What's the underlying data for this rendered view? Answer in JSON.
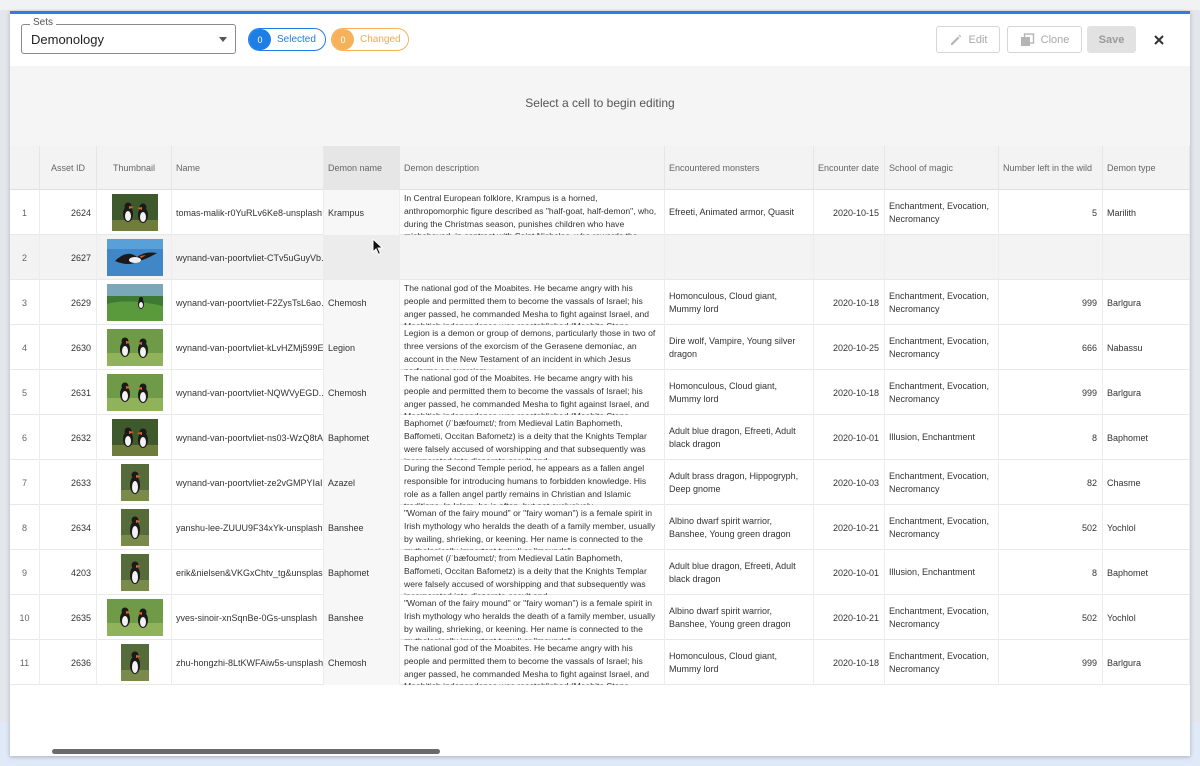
{
  "toolbar": {
    "sets_label": "Sets",
    "sets_value": "Demonology",
    "selected_count": "0",
    "selected_label": "Selected",
    "changed_count": "0",
    "changed_label": "Changed",
    "edit_label": "Edit",
    "clone_label": "Clone",
    "save_label": "Save",
    "close_icon": "close-icon"
  },
  "editor": {
    "hint": "Select a cell to begin editing"
  },
  "columns": [
    "Asset ID",
    "Thumbnail",
    "Name",
    "Demon name",
    "Demon description",
    "Encountered monsters",
    "Encounter date",
    "School of magic",
    "Number left in the wild",
    "Demon type"
  ],
  "rows": [
    {
      "index": "1",
      "asset_id": "2624",
      "thumb": "puffins-pair",
      "name": "tomas-malik-r0YuRLv6Ke8-unsplash",
      "demon_name": "Krampus",
      "description": "In Central European folklore, Krampus is a horned, anthropomorphic figure described as \"half-goat, half-demon\", who, during the Christmas season, punishes children who have misbehaved, in contrast with Saint Nicholas, who rewards the",
      "monsters": "Efreeti, Animated armor, Quasit",
      "date": "2020-10-15",
      "school": "Enchantment, Evocation, Necromancy",
      "number": "5",
      "type": "Marilith"
    },
    {
      "index": "2",
      "asset_id": "2627",
      "thumb": "puffin-flying",
      "name": "wynand-van-poortvliet-CTv5uGuyVb...",
      "demon_name": "",
      "description": "",
      "monsters": "",
      "date": "",
      "school": "",
      "number": "",
      "type": ""
    },
    {
      "index": "3",
      "asset_id": "2629",
      "thumb": "puffin-cliff",
      "name": "wynand-van-poortvliet-F2ZysTsL6ao...",
      "demon_name": "Chemosh",
      "description": "The national god of the Moabites. He became angry with his people and permitted them to become the vassals of Israel; his anger passed, he commanded Mesha to fight against Israel, and Moabitish independence was reestablished (Moabite Stone",
      "monsters": "Homonculous, Cloud giant, Mummy lord",
      "date": "2020-10-18",
      "school": "Enchantment, Evocation, Necromancy",
      "number": "999",
      "type": "Barlgura"
    },
    {
      "index": "4",
      "asset_id": "2630",
      "thumb": "puffins-grass",
      "name": "wynand-van-poortvliet-kLvHZMj599E...",
      "demon_name": "Legion",
      "description": "Legion is a demon or group of demons, particularly those in two of three versions of the exorcism of the Gerasene demoniac, an account in the New Testament of an incident in which Jesus performs an exorcism.",
      "monsters": "Dire wolf, Vampire, Young silver dragon",
      "date": "2020-10-25",
      "school": "Enchantment, Evocation, Necromancy",
      "number": "666",
      "type": "Nabassu"
    },
    {
      "index": "5",
      "asset_id": "2631",
      "thumb": "puffins-grass",
      "name": "wynand-van-poortvliet-NQWVyEGD...",
      "demon_name": "Chemosh",
      "description": "The national god of the Moabites. He became angry with his people and permitted them to become the vassals of Israel; his anger passed, he commanded Mesha to fight against Israel, and Moabitish independence was reestablished (Moabite Stone",
      "monsters": "Homonculous, Cloud giant, Mummy lord",
      "date": "2020-10-18",
      "school": "Enchantment, Evocation, Necromancy",
      "number": "999",
      "type": "Barlgura"
    },
    {
      "index": "6",
      "asset_id": "2632",
      "thumb": "puffins-pair",
      "name": "wynand-van-poortvliet-ns03-WzQ8tA...",
      "demon_name": "Baphomet",
      "description": "Baphomet (/ˈbæfoʊmɛt/; from Medieval Latin Baphometh, Baffometi, Occitan Bafometz) is a deity that the Knights Templar were falsely accused of worshipping and that subsequently was incorporated into disparate occult and",
      "monsters": "Adult blue dragon, Efreeti, Adult black dragon",
      "date": "2020-10-01",
      "school": "Illusion, Enchantment",
      "number": "8",
      "type": "Baphomet"
    },
    {
      "index": "7",
      "asset_id": "2633",
      "thumb": "puffin-tall",
      "name": "wynand-van-poortvliet-ze2vGMPYIaI...",
      "demon_name": "Azazel",
      "description": "During the Second Temple period, he appears as a fallen angel responsible for introducing humans to forbidden knowledge. His role as a fallen angel partly remains in Christian and Islamic traditions. In Islam, he is often, but not exclusively",
      "monsters": "Adult brass dragon, Hippogryph, Deep gnome",
      "date": "2020-10-03",
      "school": "Enchantment, Evocation, Necromancy",
      "number": "82",
      "type": "Chasme"
    },
    {
      "index": "8",
      "asset_id": "2634",
      "thumb": "puffin-tall",
      "name": "yanshu-lee-ZUUU9F34xYk-unsplash",
      "demon_name": "Banshee",
      "description": "\"Woman of the fairy mound\" or \"fairy woman\") is a female spirit in Irish mythology who heralds the death of a family member, usually by wailing, shrieking, or keening. Her name is connected to the mythologically important tumuli or \"mounds\"",
      "monsters": "Albino dwarf spirit warrior, Banshee, Young green dragon",
      "date": "2020-10-21",
      "school": "Enchantment, Evocation, Necromancy",
      "number": "502",
      "type": "Yochlol"
    },
    {
      "index": "9",
      "asset_id": "4203",
      "thumb": "puffin-tall",
      "name": "erik&nielsen&VKGxChtv_tg&unsplas...",
      "demon_name": "Baphomet",
      "description": "Baphomet (/ˈbæfoʊmɛt/; from Medieval Latin Baphometh, Baffometi, Occitan Bafometz) is a deity that the Knights Templar were falsely accused of worshipping and that subsequently was incorporated into disparate occult and",
      "monsters": "Adult blue dragon, Efreeti, Adult black dragon",
      "date": "2020-10-01",
      "school": "Illusion, Enchantment",
      "number": "8",
      "type": "Baphomet"
    },
    {
      "index": "10",
      "asset_id": "2635",
      "thumb": "puffins-grass",
      "name": "yves-sinoir-xnSqnBe-0Gs-unsplash",
      "demon_name": "Banshee",
      "description": "\"Woman of the fairy mound\" or \"fairy woman\") is a female spirit in Irish mythology who heralds the death of a family member, usually by wailing, shrieking, or keening. Her name is connected to the mythologically important tumuli or \"mounds\"",
      "monsters": "Albino dwarf spirit warrior, Banshee, Young green dragon",
      "date": "2020-10-21",
      "school": "Enchantment, Evocation, Necromancy",
      "number": "502",
      "type": "Yochlol"
    },
    {
      "index": "11",
      "asset_id": "2636",
      "thumb": "puffin-tall",
      "name": "zhu-hongzhi-8LtKWFAiw5s-unsplash",
      "demon_name": "Chemosh",
      "description": "The national god of the Moabites. He became angry with his people and permitted them to become the vassals of Israel; his anger passed, he commanded Mesha to fight against Israel, and Moabitish independence was reestablished (Moabite Stone",
      "monsters": "Homonculous, Cloud giant, Mummy lord",
      "date": "2020-10-18",
      "school": "Enchantment, Evocation, Necromancy",
      "number": "999",
      "type": "Barlgura"
    }
  ],
  "colors": {
    "accent": "#1e7ee6",
    "changed": "#f5b25a",
    "top_border": "#2f7de1"
  }
}
